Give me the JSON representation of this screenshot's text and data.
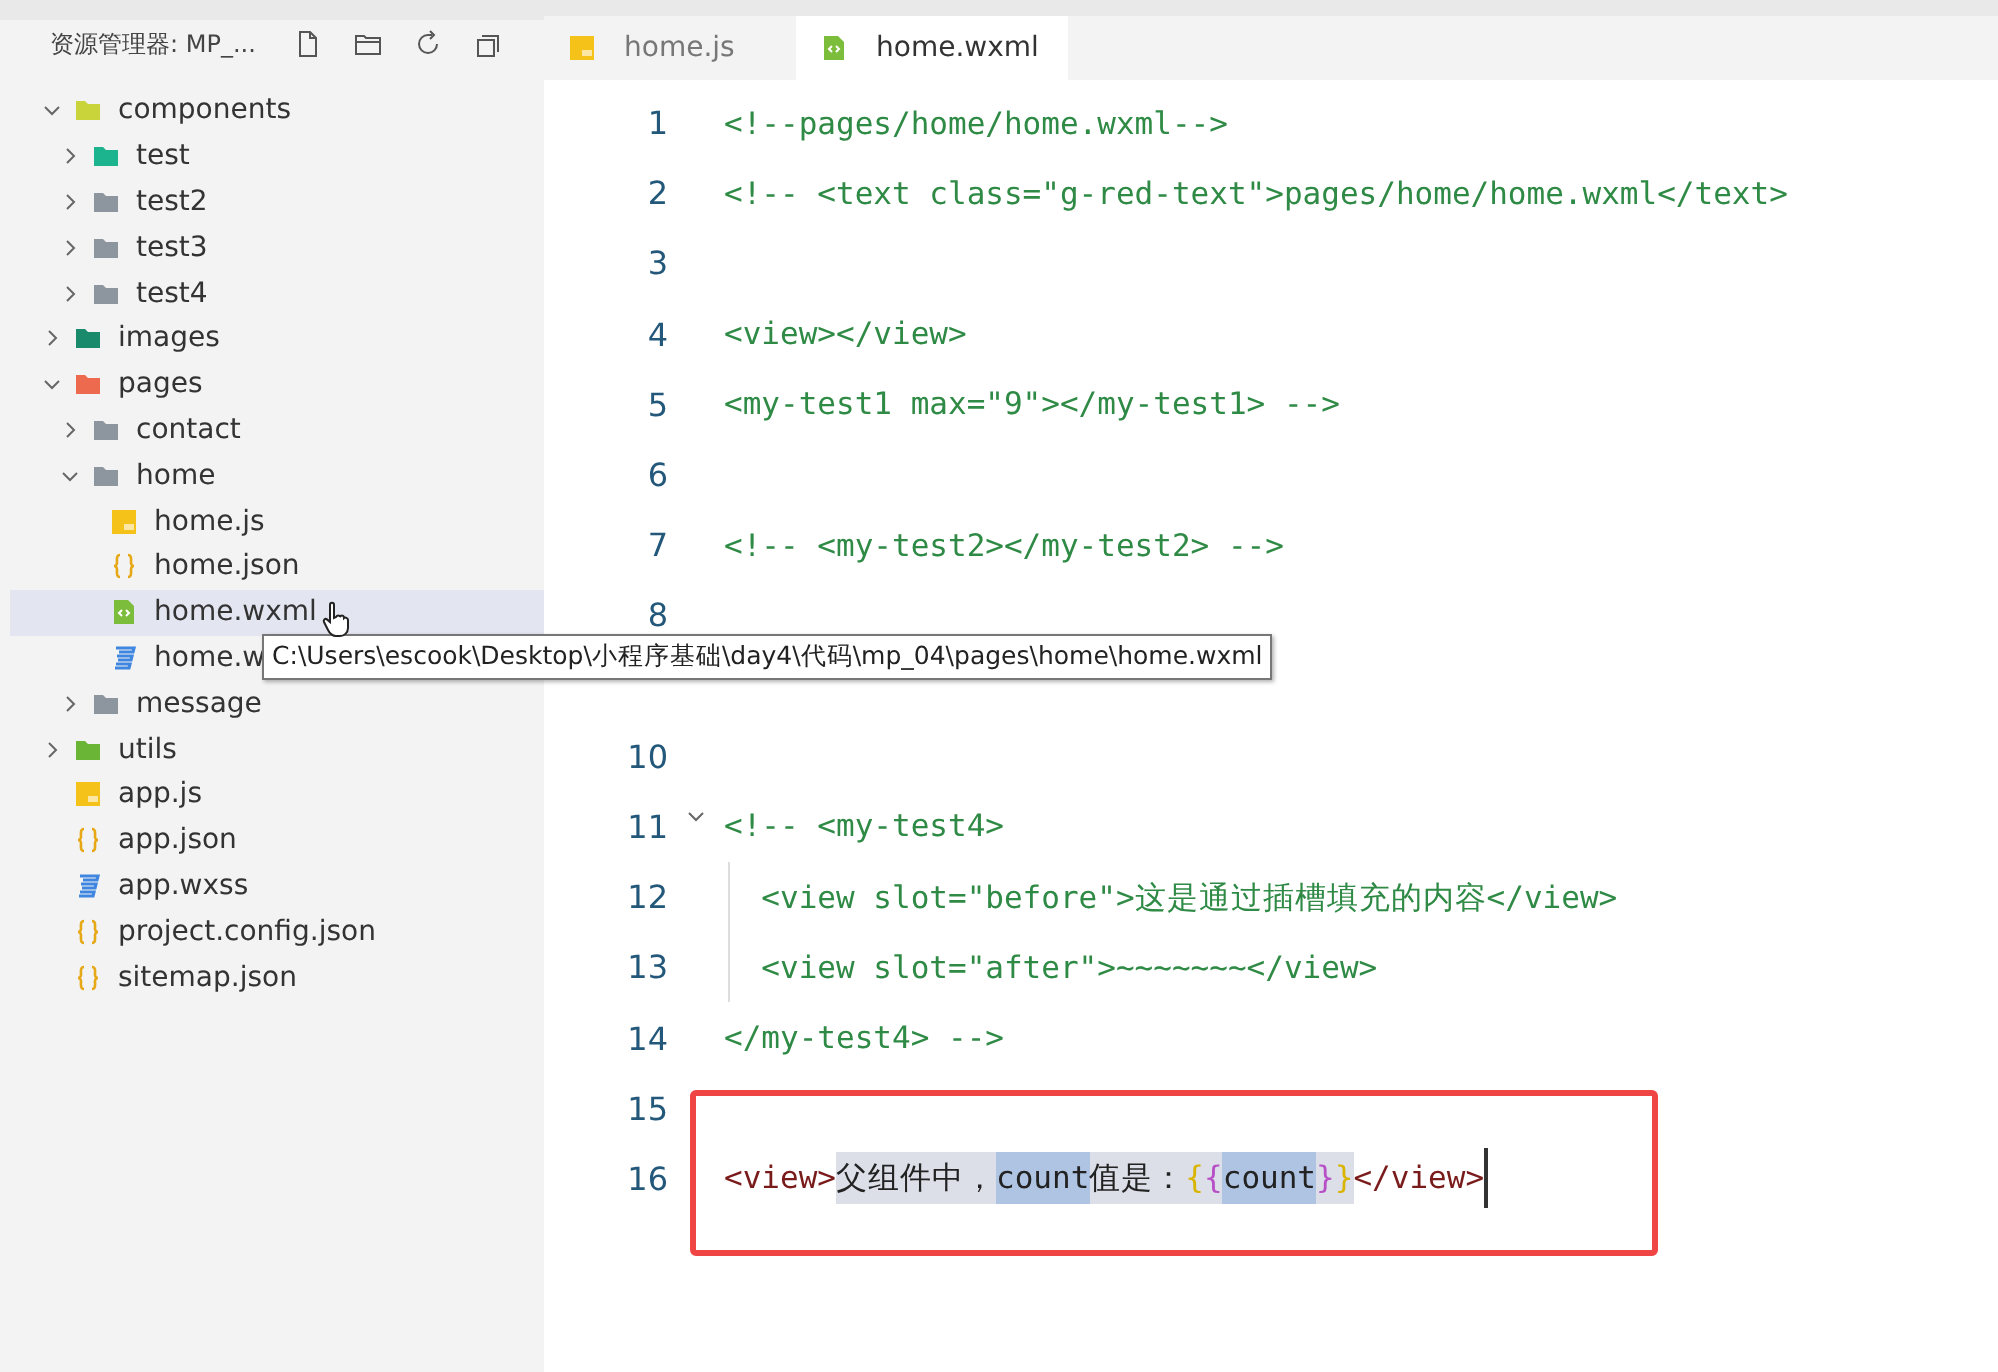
{
  "explorer": {
    "title": "资源管理器: MP_...",
    "tree": [
      {
        "name": "components",
        "kind": "folder",
        "color": "#c8d43a",
        "expanded": true,
        "selected": false,
        "children": [
          {
            "name": "test",
            "kind": "folder",
            "color": "#1bb48f",
            "expanded": false,
            "selected": false
          },
          {
            "name": "test2",
            "kind": "folder",
            "color": "#8d959e",
            "expanded": false,
            "selected": false
          },
          {
            "name": "test3",
            "kind": "folder",
            "color": "#8d959e",
            "expanded": false,
            "selected": false
          },
          {
            "name": "test4",
            "kind": "folder",
            "color": "#8d959e",
            "expanded": false,
            "selected": false
          }
        ]
      },
      {
        "name": "images",
        "kind": "folder",
        "color": "#198a6c",
        "expanded": false,
        "selected": false
      },
      {
        "name": "pages",
        "kind": "folder",
        "color": "#ee6a4f",
        "expanded": true,
        "selected": false,
        "children": [
          {
            "name": "contact",
            "kind": "folder",
            "color": "#8d959e",
            "expanded": false,
            "selected": false
          },
          {
            "name": "home",
            "kind": "folder",
            "color": "#8d959e",
            "expanded": true,
            "selected": false,
            "children": [
              {
                "name": "home.js",
                "kind": "js",
                "selected": false
              },
              {
                "name": "home.json",
                "kind": "json",
                "selected": false
              },
              {
                "name": "home.wxml",
                "kind": "wxml",
                "selected": true
              },
              {
                "name": "home.w",
                "kind": "wxss",
                "selected": false
              }
            ]
          },
          {
            "name": "message",
            "kind": "folder",
            "color": "#8d959e",
            "expanded": false,
            "selected": false
          }
        ]
      },
      {
        "name": "utils",
        "kind": "folder",
        "color": "#6bb536",
        "expanded": false,
        "selected": false
      },
      {
        "name": "app.js",
        "kind": "js",
        "selected": false
      },
      {
        "name": "app.json",
        "kind": "json",
        "selected": false
      },
      {
        "name": "app.wxss",
        "kind": "wxss",
        "selected": false
      },
      {
        "name": "project.config.json",
        "kind": "json",
        "selected": false
      },
      {
        "name": "sitemap.json",
        "kind": "json",
        "selected": false
      }
    ]
  },
  "tooltip": "C:\\Users\\escook\\Desktop\\小程序基础\\day4\\代码\\mp_04\\pages\\home\\home.wxml",
  "tabs": [
    {
      "label": "home.js",
      "kind": "js",
      "selected": false
    },
    {
      "label": "home.wxml",
      "kind": "wxml",
      "selected": true
    }
  ],
  "lines": [
    {
      "kind": "code",
      "number": "1",
      "segments": [
        {
          "text": "<!--pages/home/home.wxml-->",
          "kind": "comment"
        }
      ]
    },
    {
      "kind": "code",
      "number": "2",
      "segments": [
        {
          "text": "<!-- <text class=\"g-red-text\">pages/home/home.wxml</text>",
          "kind": "comment"
        }
      ]
    },
    {
      "kind": "code",
      "number": "3"
    },
    {
      "kind": "code",
      "number": "4",
      "segments": [
        {
          "text": "<view></view>",
          "kind": "comment"
        }
      ]
    },
    {
      "kind": "code",
      "number": "5",
      "segments": [
        {
          "text": "<my-test1 max=\"9\"></my-test1> -->",
          "kind": "comment"
        }
      ]
    },
    {
      "kind": "code",
      "number": "6"
    },
    {
      "kind": "code",
      "number": "7",
      "segments": [
        {
          "text": "<!-- <my-test2></my-test2> -->",
          "kind": "comment"
        }
      ]
    },
    {
      "kind": "code",
      "number": "8"
    },
    {
      "kind": "hidden"
    },
    {
      "kind": "code",
      "number": "10"
    },
    {
      "kind": "code",
      "number": "11",
      "expanded": true,
      "segments": [
        {
          "text": "<!-- <my-test4>",
          "kind": "comment"
        }
      ]
    },
    {
      "kind": "code",
      "number": "12",
      "guide": true,
      "segments": [
        {
          "text": "  <view slot=\"before\">这是通过插槽填充的内容</view>",
          "kind": "comment"
        }
      ]
    },
    {
      "kind": "code",
      "number": "13",
      "guide": true,
      "segments": [
        {
          "text": "  <view slot=\"after\">~~~~~~~</view>",
          "kind": "comment"
        }
      ]
    },
    {
      "kind": "code",
      "number": "14",
      "segments": [
        {
          "text": "</my-test4> -->",
          "kind": "comment"
        }
      ]
    },
    {
      "kind": "code",
      "number": "15"
    },
    {
      "kind": "code",
      "number": "16",
      "cursor": true,
      "segments": [
        {
          "text": "<view>",
          "kind": "tag",
          "selected": false,
          "match": false
        },
        {
          "text": "父组件中，",
          "kind": "text",
          "selected": true,
          "match": false
        },
        {
          "text": "count",
          "kind": "text",
          "match": true
        },
        {
          "text": "值是：",
          "kind": "text",
          "selected": true,
          "match": false
        },
        {
          "text": "{",
          "kind": "brace1",
          "selected": true,
          "match": false
        },
        {
          "text": "{",
          "kind": "brace2",
          "selected": true,
          "match": false
        },
        {
          "text": "count",
          "kind": "text",
          "match": true
        },
        {
          "text": "}",
          "kind": "brace2",
          "selected": true,
          "match": false
        },
        {
          "text": "}",
          "kind": "brace1",
          "selected": true,
          "match": false
        },
        {
          "text": "</view>",
          "kind": "tag",
          "selected": false,
          "match": false
        }
      ]
    }
  ]
}
